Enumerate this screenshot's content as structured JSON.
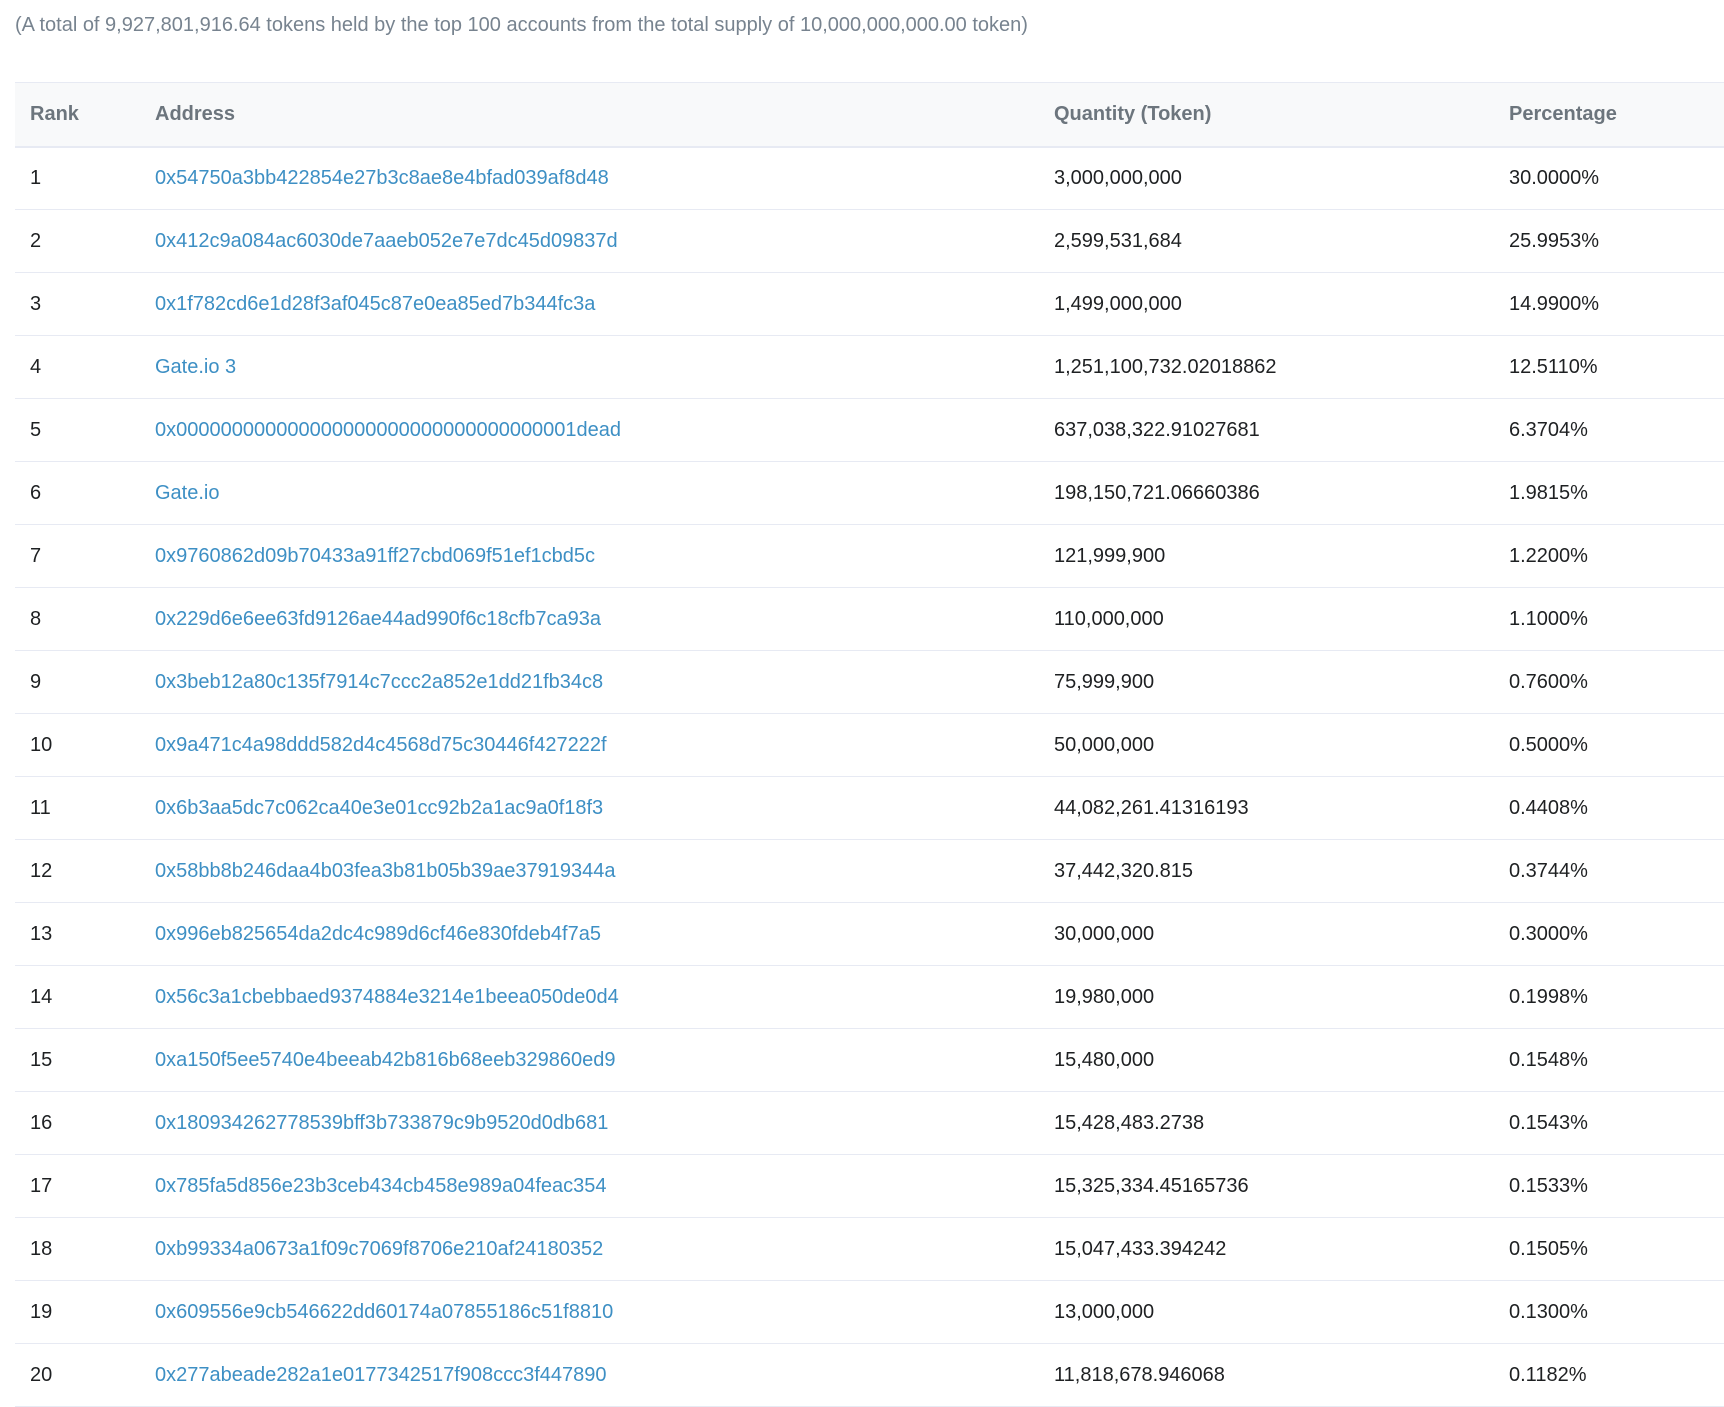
{
  "summary": "(A total of 9,927,801,916.64 tokens held by the top 100 accounts from the total supply of 10,000,000,000.00 token)",
  "table": {
    "headers": {
      "rank": "Rank",
      "address": "Address",
      "quantity": "Quantity (Token)",
      "percentage": "Percentage"
    },
    "rows": [
      {
        "rank": "1",
        "address": "0x54750a3bb422854e27b3c8ae8e4bfad039af8d48",
        "quantity": "3,000,000,000",
        "percentage": "30.0000%"
      },
      {
        "rank": "2",
        "address": "0x412c9a084ac6030de7aaeb052e7e7dc45d09837d",
        "quantity": "2,599,531,684",
        "percentage": "25.9953%"
      },
      {
        "rank": "3",
        "address": "0x1f782cd6e1d28f3af045c87e0ea85ed7b344fc3a",
        "quantity": "1,499,000,000",
        "percentage": "14.9900%"
      },
      {
        "rank": "4",
        "address": "Gate.io 3",
        "quantity": "1,251,100,732.02018862",
        "percentage": "12.5110%"
      },
      {
        "rank": "5",
        "address": "0x000000000000000000000000000000000001dead",
        "quantity": "637,038,322.91027681",
        "percentage": "6.3704%"
      },
      {
        "rank": "6",
        "address": "Gate.io",
        "quantity": "198,150,721.06660386",
        "percentage": "1.9815%"
      },
      {
        "rank": "7",
        "address": "0x9760862d09b70433a91ff27cbd069f51ef1cbd5c",
        "quantity": "121,999,900",
        "percentage": "1.2200%"
      },
      {
        "rank": "8",
        "address": "0x229d6e6ee63fd9126ae44ad990f6c18cfb7ca93a",
        "quantity": "110,000,000",
        "percentage": "1.1000%"
      },
      {
        "rank": "9",
        "address": "0x3beb12a80c135f7914c7ccc2a852e1dd21fb34c8",
        "quantity": "75,999,900",
        "percentage": "0.7600%"
      },
      {
        "rank": "10",
        "address": "0x9a471c4a98ddd582d4c4568d75c30446f427222f",
        "quantity": "50,000,000",
        "percentage": "0.5000%"
      },
      {
        "rank": "11",
        "address": "0x6b3aa5dc7c062ca40e3e01cc92b2a1ac9a0f18f3",
        "quantity": "44,082,261.41316193",
        "percentage": "0.4408%"
      },
      {
        "rank": "12",
        "address": "0x58bb8b246daa4b03fea3b81b05b39ae37919344a",
        "quantity": "37,442,320.815",
        "percentage": "0.3744%"
      },
      {
        "rank": "13",
        "address": "0x996eb825654da2dc4c989d6cf46e830fdeb4f7a5",
        "quantity": "30,000,000",
        "percentage": "0.3000%"
      },
      {
        "rank": "14",
        "address": "0x56c3a1cbebbaed9374884e3214e1beea050de0d4",
        "quantity": "19,980,000",
        "percentage": "0.1998%"
      },
      {
        "rank": "15",
        "address": "0xa150f5ee5740e4beeab42b816b68eeb329860ed9",
        "quantity": "15,480,000",
        "percentage": "0.1548%"
      },
      {
        "rank": "16",
        "address": "0x180934262778539bff3b733879c9b9520d0db681",
        "quantity": "15,428,483.2738",
        "percentage": "0.1543%"
      },
      {
        "rank": "17",
        "address": "0x785fa5d856e23b3ceb434cb458e989a04feac354",
        "quantity": "15,325,334.45165736",
        "percentage": "0.1533%"
      },
      {
        "rank": "18",
        "address": "0xb99334a0673a1f09c7069f8706e210af24180352",
        "quantity": "15,047,433.394242",
        "percentage": "0.1505%"
      },
      {
        "rank": "19",
        "address": "0x609556e9cb546622dd60174a07855186c51f8810",
        "quantity": "13,000,000",
        "percentage": "0.1300%"
      },
      {
        "rank": "20",
        "address": "0x277abeade282a1e0177342517f908ccc3f447890",
        "quantity": "11,818,678.946068",
        "percentage": "0.1182%"
      }
    ]
  },
  "colors": {
    "link": "#3d8fc4",
    "muted_text": "#77838f",
    "header_bg": "#f8f9fa",
    "border": "#e7eaf3"
  }
}
